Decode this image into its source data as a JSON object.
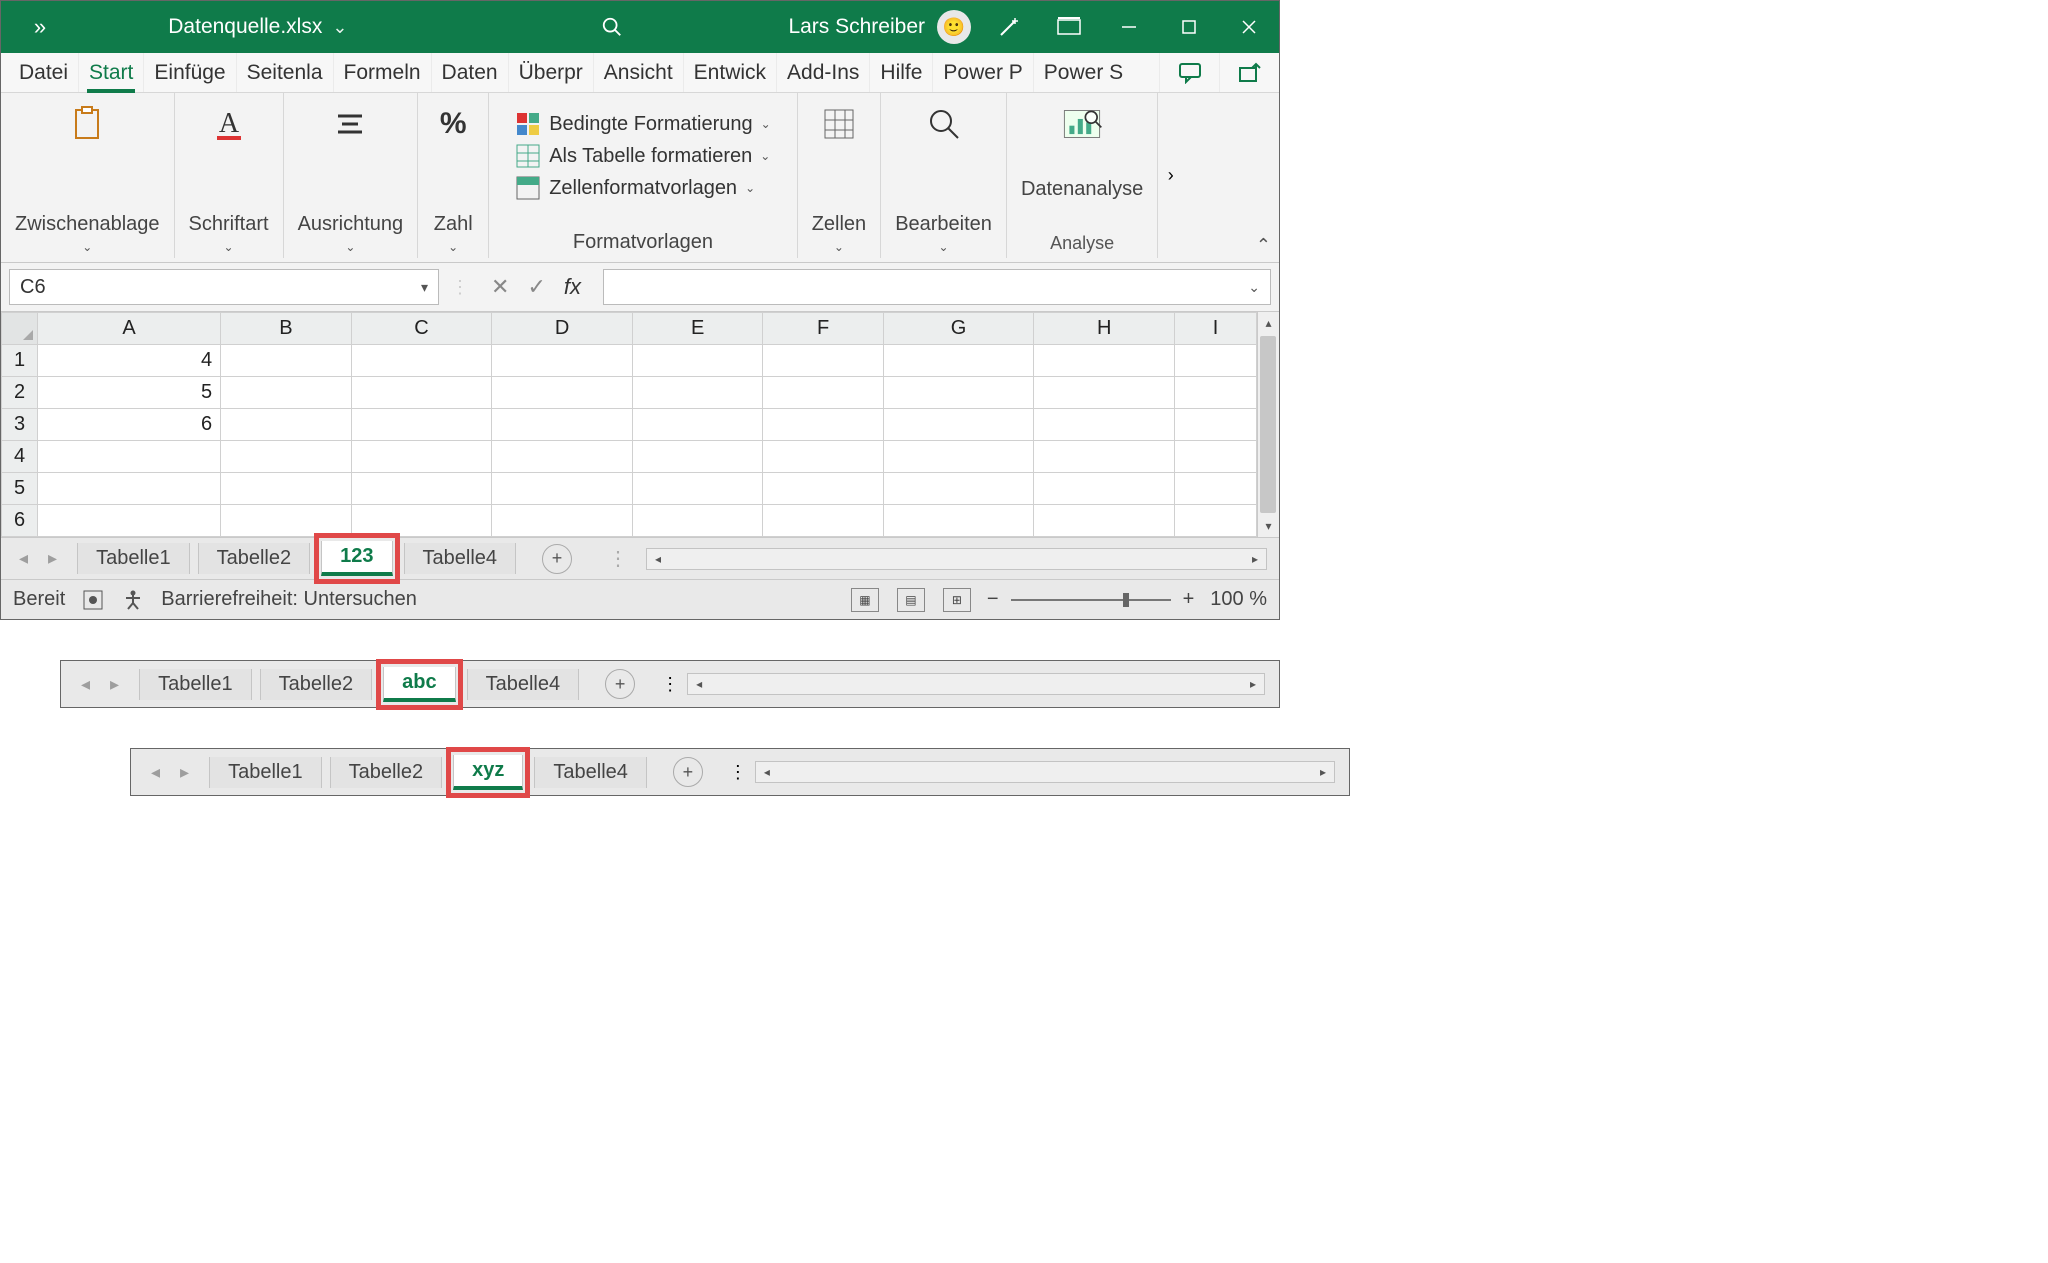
{
  "title": "Datenquelle.xlsx",
  "user": "Lars Schreiber",
  "ribbon": {
    "tabs": [
      "Datei",
      "Start",
      "Einfüge",
      "Seitenla",
      "Formeln",
      "Daten",
      "Überpr",
      "Ansicht",
      "Entwick",
      "Add-Ins",
      "Hilfe",
      "Power P",
      "Power S"
    ],
    "active": "Start",
    "groups": {
      "clipboard": "Zwischenablage",
      "font": "Schriftart",
      "align": "Ausrichtung",
      "number": "Zahl",
      "styles_label": "Formatvorlagen",
      "cond_fmt": "Bedingte Formatierung",
      "as_table": "Als Tabelle formatieren",
      "cell_styles": "Zellenformatvorlagen",
      "cells": "Zellen",
      "editing": "Bearbeiten",
      "analysis": "Datenanalyse",
      "analysis_label": "Analyse"
    }
  },
  "percent_sign": "%",
  "namebox": "C6",
  "formula": "",
  "columns": [
    "A",
    "B",
    "C",
    "D",
    "E",
    "F",
    "G",
    "H",
    "I"
  ],
  "rows": [
    "1",
    "2",
    "3",
    "4",
    "5",
    "6"
  ],
  "cells": {
    "A1": "4",
    "A2": "5",
    "A3": "6"
  },
  "sheets_main": [
    "Tabelle1",
    "Tabelle2",
    "123",
    "Tabelle4"
  ],
  "sheets_v2": [
    "Tabelle1",
    "Tabelle2",
    "abc",
    "Tabelle4"
  ],
  "sheets_v3": [
    "Tabelle1",
    "Tabelle2",
    "xyz",
    "Tabelle4"
  ],
  "status": {
    "ready": "Bereit",
    "a11y": "Barrierefreiheit: Untersuchen",
    "zoom": "100 %"
  },
  "fx_label": "fx"
}
